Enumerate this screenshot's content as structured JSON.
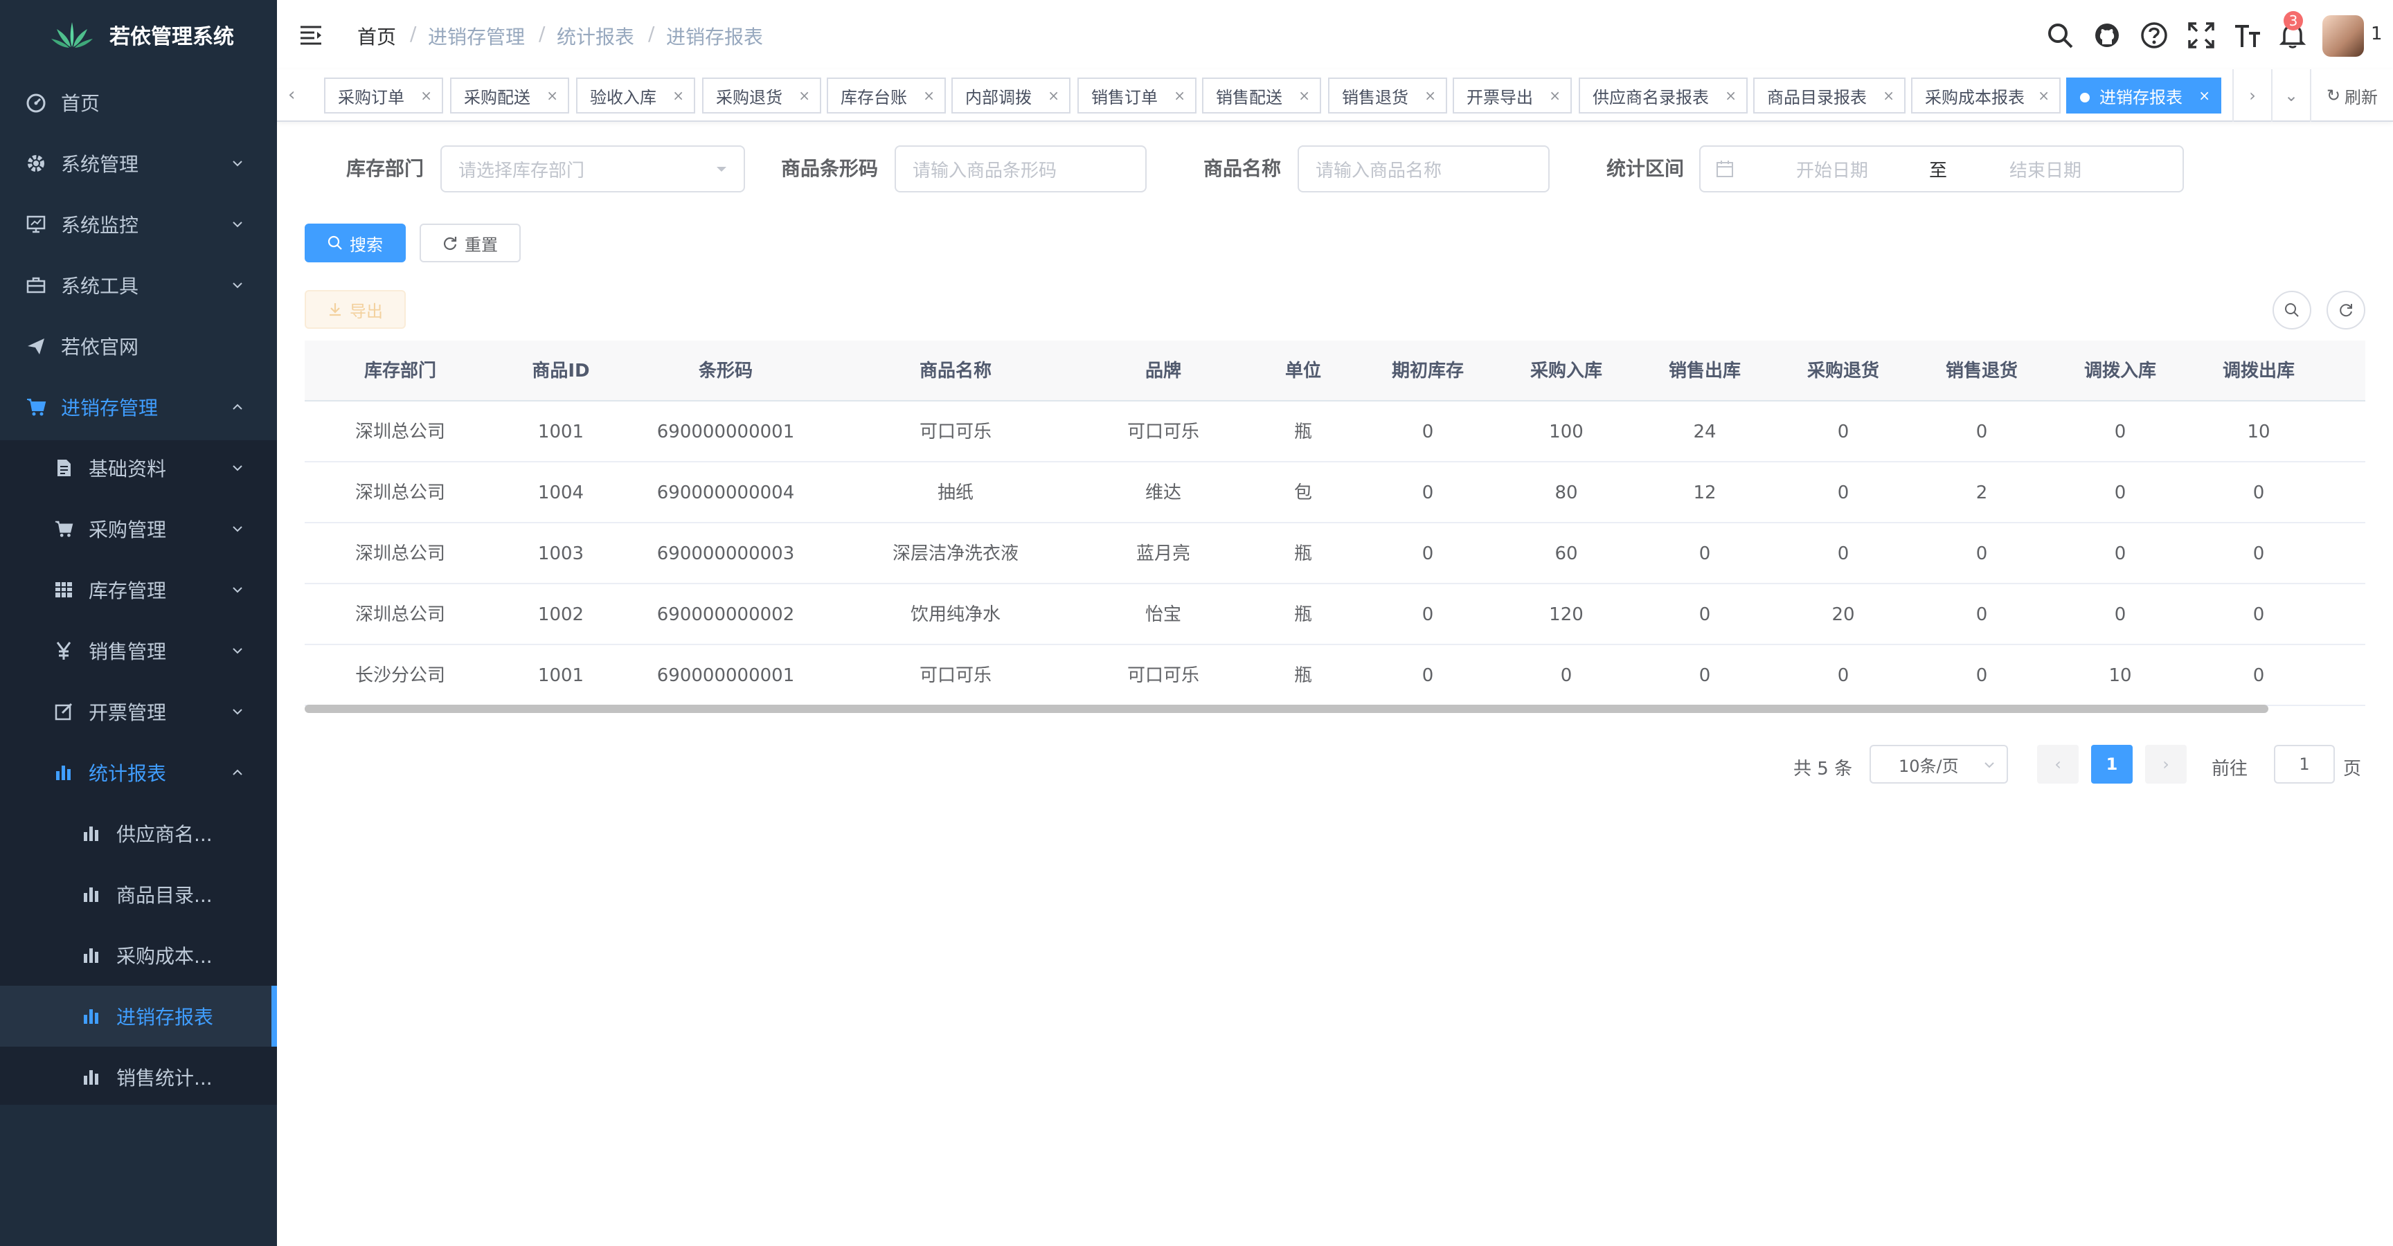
{
  "app": {
    "title": "若依管理系统"
  },
  "sidebar": {
    "items": [
      {
        "label": "首页"
      },
      {
        "label": "系统管理"
      },
      {
        "label": "系统监控"
      },
      {
        "label": "系统工具"
      },
      {
        "label": "若依官网"
      },
      {
        "label": "进销存管理"
      },
      {
        "label": "基础资料"
      },
      {
        "label": "采购管理"
      },
      {
        "label": "库存管理"
      },
      {
        "label": "销售管理"
      },
      {
        "label": "开票管理"
      },
      {
        "label": "统计报表"
      },
      {
        "label": "供应商名..."
      },
      {
        "label": "商品目录..."
      },
      {
        "label": "采购成本..."
      },
      {
        "label": "进销存报表"
      },
      {
        "label": "销售统计..."
      }
    ]
  },
  "breadcrumb": [
    "首页",
    "进销存管理",
    "统计报表",
    "进销存报表"
  ],
  "header": {
    "notification_count": "3",
    "user_suffix": "1"
  },
  "tags": [
    {
      "label": "采购订单"
    },
    {
      "label": "采购配送"
    },
    {
      "label": "验收入库"
    },
    {
      "label": "采购退货"
    },
    {
      "label": "库存台账"
    },
    {
      "label": "内部调拨"
    },
    {
      "label": "销售订单"
    },
    {
      "label": "销售配送"
    },
    {
      "label": "销售退货"
    },
    {
      "label": "开票导出"
    },
    {
      "label": "供应商名录报表"
    },
    {
      "label": "商品目录报表"
    },
    {
      "label": "采购成本报表"
    },
    {
      "label": "进销存报表"
    }
  ],
  "tags_refresh": "刷新",
  "tag_close": "×",
  "form": {
    "dept_label": "库存部门",
    "dept_placeholder": "请选择库存部门",
    "barcode_label": "商品条形码",
    "barcode_placeholder": "请输入商品条形码",
    "name_label": "商品名称",
    "name_placeholder": "请输入商品名称",
    "range_label": "统计区间",
    "start_placeholder": "开始日期",
    "range_sep": "至",
    "end_placeholder": "结束日期",
    "search_btn": "搜索",
    "reset_btn": "重置",
    "export_btn": "导出"
  },
  "table": {
    "columns": [
      "库存部门",
      "商品ID",
      "条形码",
      "商品名称",
      "品牌",
      "单位",
      "期初库存",
      "采购入库",
      "销售出库",
      "采购退货",
      "销售退货",
      "调拨入库",
      "调拨出库"
    ],
    "rows": [
      [
        "深圳总公司",
        "1001",
        "690000000001",
        "可口可乐",
        "可口可乐",
        "瓶",
        "0",
        "100",
        "24",
        "0",
        "0",
        "0",
        "10"
      ],
      [
        "深圳总公司",
        "1004",
        "690000000004",
        "抽纸",
        "维达",
        "包",
        "0",
        "80",
        "12",
        "0",
        "2",
        "0",
        "0"
      ],
      [
        "深圳总公司",
        "1003",
        "690000000003",
        "深层洁净洗衣液",
        "蓝月亮",
        "瓶",
        "0",
        "60",
        "0",
        "0",
        "0",
        "0",
        "0"
      ],
      [
        "深圳总公司",
        "1002",
        "690000000002",
        "饮用纯净水",
        "怡宝",
        "瓶",
        "0",
        "120",
        "0",
        "20",
        "0",
        "0",
        "0"
      ],
      [
        "长沙分公司",
        "1001",
        "690000000001",
        "可口可乐",
        "可口可乐",
        "瓶",
        "0",
        "0",
        "0",
        "0",
        "0",
        "10",
        "0"
      ]
    ]
  },
  "pagination": {
    "total": "共 5 条",
    "page_size": "10条/页",
    "current_page": "1",
    "goto_label": "前往",
    "goto_value": "1",
    "page_unit": "页"
  }
}
